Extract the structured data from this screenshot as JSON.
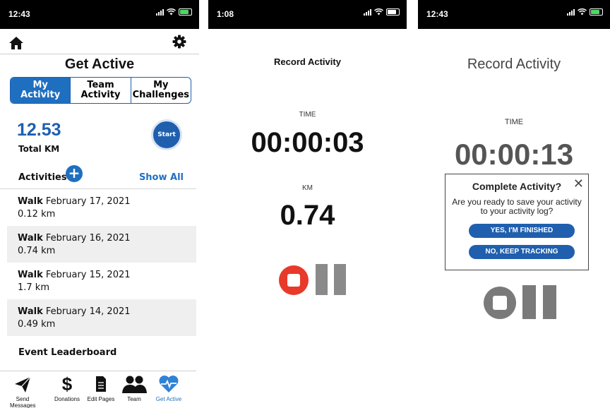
{
  "panel1": {
    "status_time": "12:43",
    "page_title": "Get Active",
    "tabs": [
      {
        "line1": "My",
        "line2": "Activity"
      },
      {
        "line1": "Team",
        "line2": "Activity"
      },
      {
        "line1": "My",
        "line2": "Challenges"
      }
    ],
    "total_value": "12.53",
    "total_label": "Total KM",
    "start_label": "Start",
    "activities_heading": "Activities",
    "show_all": "Show All",
    "activities": [
      {
        "type": "Walk",
        "date": "February 17, 2021",
        "distance": "0.12 km"
      },
      {
        "type": "Walk",
        "date": "February 16, 2021",
        "distance": "0.74 km"
      },
      {
        "type": "Walk",
        "date": "February 15, 2021",
        "distance": "1.7 km"
      },
      {
        "type": "Walk",
        "date": "February 14, 2021",
        "distance": "0.49 km"
      }
    ],
    "leaderboard_heading": "Event Leaderboard",
    "nav": [
      {
        "label": "Send Messages",
        "icon": "send-icon"
      },
      {
        "label": "Donations",
        "icon": "dollar-icon"
      },
      {
        "label": "Edit Pages",
        "icon": "document-icon"
      },
      {
        "label": "Team",
        "icon": "team-icon"
      },
      {
        "label": "Get Active",
        "icon": "heart-pulse-icon"
      }
    ],
    "accent": "#1f5fae"
  },
  "panel2": {
    "status_time": "1:08",
    "title": "Record Activity",
    "time_label": "TIME",
    "time_value": "00:00:03",
    "km_label": "KM",
    "km_value": "0.74",
    "stop_color": "#e8392a"
  },
  "panel3": {
    "status_time": "12:43",
    "title": "Record Activity",
    "time_label": "TIME",
    "time_value": "00:00:13",
    "modal_title": "Complete Activity?",
    "modal_text": "Are you ready to save your activity to your activity log?",
    "confirm_button": "YES, I'M FINISHED",
    "cancel_button": "NO, KEEP TRACKING"
  }
}
